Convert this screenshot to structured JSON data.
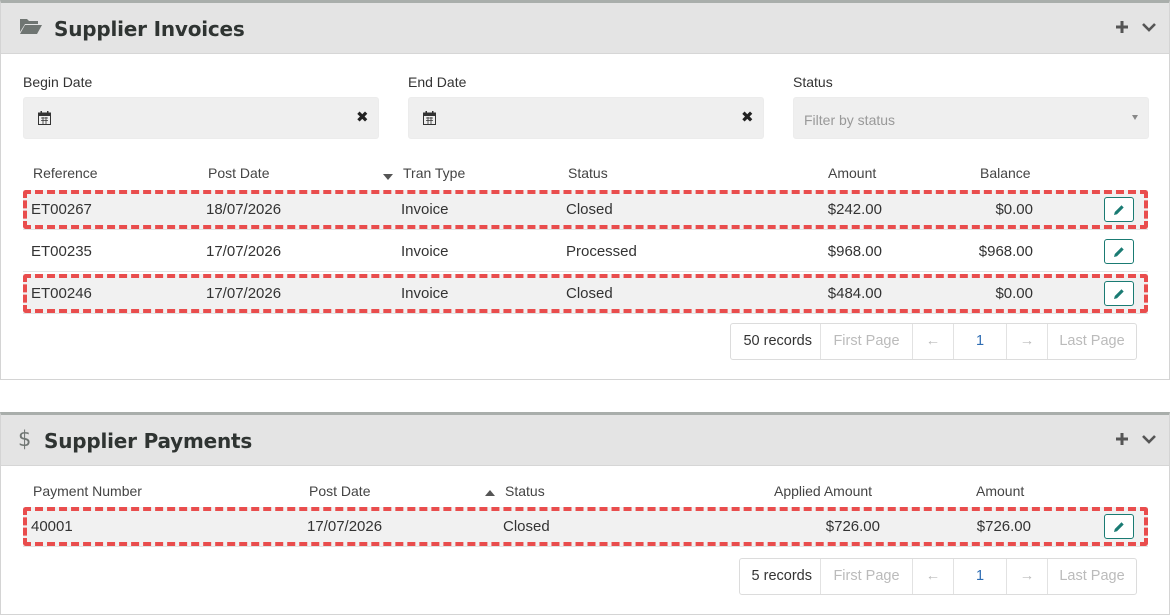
{
  "invoices": {
    "title": "Supplier Invoices",
    "filters": {
      "begin_label": "Begin Date",
      "end_label": "End Date",
      "status_label": "Status",
      "status_placeholder": "Filter by status",
      "clear_symbol": "✖"
    },
    "columns": [
      "Reference",
      "Post Date",
      "Tran Type",
      "Status",
      "Amount",
      "Balance"
    ],
    "rows": [
      {
        "reference": "ET00267",
        "post_date": "18/07/2026",
        "tran_type": "Invoice",
        "status": "Closed",
        "amount": "$242.00",
        "balance": "$0.00",
        "highlighted": true
      },
      {
        "reference": "ET00235",
        "post_date": "17/07/2026",
        "tran_type": "Invoice",
        "status": "Processed",
        "amount": "$968.00",
        "balance": "$968.00",
        "highlighted": false
      },
      {
        "reference": "ET00246",
        "post_date": "17/07/2026",
        "tran_type": "Invoice",
        "status": "Closed",
        "amount": "$484.00",
        "balance": "$0.00",
        "highlighted": true
      }
    ],
    "pager": {
      "records": "50 records",
      "first": "First Page",
      "prev": "←",
      "page": "1",
      "next": "→",
      "last": "Last Page"
    }
  },
  "payments": {
    "title": "Supplier Payments",
    "columns": [
      "Payment Number",
      "Post Date",
      "Status",
      "Applied Amount",
      "Amount"
    ],
    "rows": [
      {
        "payment_number": "40001",
        "post_date": "17/07/2026",
        "status": "Closed",
        "applied_amount": "$726.00",
        "amount": "$726.00",
        "highlighted": true
      }
    ],
    "pager": {
      "records": "5 records",
      "first": "First Page",
      "prev": "←",
      "page": "1",
      "next": "→",
      "last": "Last Page"
    }
  },
  "icons": {
    "invoices_header": "folder-open-icon",
    "payments_header": "dollar-icon",
    "add": "plus-icon",
    "collapse": "chevron-down-icon",
    "date": "calendar-icon",
    "clear": "clear-icon",
    "edit": "pencil-icon"
  },
  "colors": {
    "highlight_border": "#e94d4d",
    "accent_teal": "#1a7b73",
    "page_link": "#2f6db3",
    "header_bg": "#e4e4e4"
  }
}
